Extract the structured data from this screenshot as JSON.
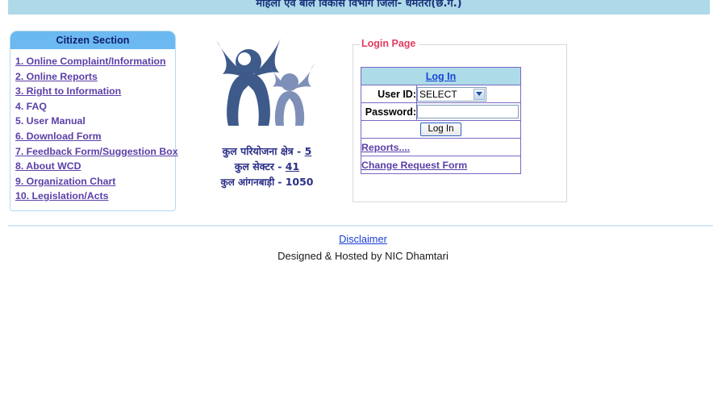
{
  "header": {
    "title": "महिला एवं बाल विकास विभाग जिला- धमतरी(छ.ग.)",
    "band_color": "#aed9e8"
  },
  "sidebar": {
    "heading": "Citizen Section",
    "heading_bg": "#6cb9f2",
    "link_color": "#5b3fa8",
    "items": [
      {
        "label": "1. Online Complaint/Information",
        "is_link": true
      },
      {
        "label": "2. Online Reports",
        "is_link": true
      },
      {
        "label": "3. Right to Information",
        "is_link": true
      },
      {
        "label": "4. FAQ",
        "is_link": false
      },
      {
        "label": "5. User Manual",
        "is_link": false
      },
      {
        "label": "6. Download Form",
        "is_link": true
      },
      {
        "label": "7. Feedback Form/Suggestion Box",
        "is_link": true
      },
      {
        "label": "8. About WCD",
        "is_link": true
      },
      {
        "label": "9. Organization Chart",
        "is_link": true
      },
      {
        "label": "10. Legislation/Acts",
        "is_link": true
      }
    ]
  },
  "logo": {
    "name": "wcd-mother-child-logo",
    "color_dark": "#3d5a8a",
    "color_light": "#7f90b8"
  },
  "stats": [
    {
      "label": "कुल परियोजना क्षेत्र -",
      "value": "5",
      "underlined": true
    },
    {
      "label": "कुल सेक्टर -",
      "value": "41",
      "underlined": true
    },
    {
      "label": "कुल आंगनबाड़ी -",
      "value": "1050",
      "underlined": false
    }
  ],
  "login": {
    "legend": "Login Page",
    "legend_color": "#e13c62",
    "table_header": "Log In",
    "userid_label": "User ID:",
    "userid_selected": "SELECT",
    "userid_options": [
      "SELECT"
    ],
    "password_label": "Password:",
    "password_value": "",
    "submit_label": "Log In",
    "links": [
      {
        "label": "Reports...."
      },
      {
        "label": "Change Request Form"
      }
    ]
  },
  "footer": {
    "disclaimer": "Disclaimer",
    "credit": "Designed & Hosted by NIC Dhamtari"
  }
}
